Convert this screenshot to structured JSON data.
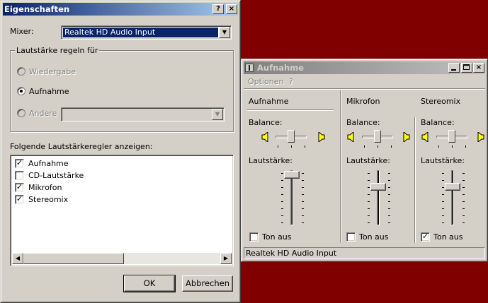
{
  "eigenschaften": {
    "title": "Eigenschaften",
    "help_button": "?",
    "close_button": "×",
    "mixer_label": "Mixer:",
    "mixer_value": "Realtek HD Audio Input",
    "group_title": "Lautstärke regeln für",
    "radio_wiedergabe": "Wiedergabe",
    "radio_aufnahme": "Aufnahme",
    "radio_andere": "Andere",
    "list_label": "Folgende Lautstärkeregler anzeigen:",
    "items": [
      {
        "label": "Aufnahme",
        "checked": true
      },
      {
        "label": "CD-Lautstärke",
        "checked": false
      },
      {
        "label": "Mikrofon",
        "checked": true
      },
      {
        "label": "Stereomix",
        "checked": true
      }
    ],
    "ok_button": "OK",
    "cancel_button": "Abbrechen"
  },
  "aufnahme": {
    "title": "Aufnahme",
    "menu_optionen": "Optionen",
    "menu_help": "?",
    "channels": [
      {
        "name": "Aufnahme",
        "balance_label": "Balance:",
        "volume_label": "Lautstärke:",
        "volume_level": 0.95,
        "mute_label": "Ton aus",
        "muted": false
      },
      {
        "name": "Mikrofon",
        "balance_label": "Balance:",
        "volume_label": "Lautstärke:",
        "volume_level": 0.7,
        "mute_label": "Ton aus",
        "muted": false
      },
      {
        "name": "Stereomix",
        "balance_label": "Balance:",
        "volume_label": "Lautstärke:",
        "volume_level": 0.7,
        "mute_label": "Ton aus",
        "muted": true
      }
    ],
    "status_text": "Realtek HD Audio Input"
  },
  "colors": {
    "desktop": "#800000",
    "title_active": "#0a246a",
    "window_face": "#d4d0c8"
  }
}
